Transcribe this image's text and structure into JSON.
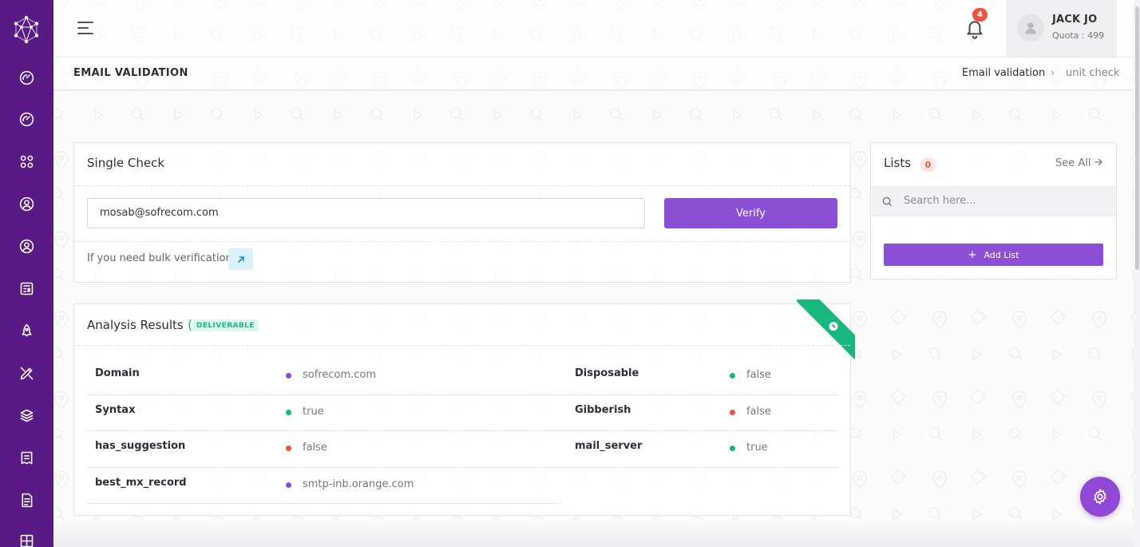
{
  "header": {
    "notification_count": "4",
    "user_name": "JACK JO",
    "user_quota": "Quota : 499"
  },
  "page": {
    "title": "EMAIL VALIDATION",
    "breadcrumb": [
      "Email validation",
      "unit check"
    ]
  },
  "single_check": {
    "title": "Single Check",
    "email_value": "mosab@sofrecom.com",
    "verify_label": "Verify",
    "bulk_text": "If you need bulk verification"
  },
  "analysis": {
    "title": "Analysis Results",
    "paren": "(",
    "status_badge": "DELIVERABLE",
    "rows": [
      {
        "label": "Domain",
        "value": "sofrecom.com",
        "dot": "#8b4fd5"
      },
      {
        "label": "Syntax",
        "value": "true",
        "dot": "#18b87c"
      },
      {
        "label": "has_suggestion",
        "value": "false",
        "dot": "#f0533b"
      },
      {
        "label": "best_mx_record",
        "value": "smtp-inb.orange.com",
        "dot": "#8b4fd5"
      },
      {
        "label": "Disposable",
        "value": "false",
        "dot": "#18b87c"
      },
      {
        "label": "Gibberish",
        "value": "false",
        "dot": "#f0533b"
      },
      {
        "label": "mail_server",
        "value": "true",
        "dot": "#18b87c"
      }
    ]
  },
  "lists": {
    "title": "Lists",
    "count": "0",
    "see_all_label": "See All",
    "search_placeholder": "Search here...",
    "add_list_label": "Add List"
  },
  "colors": {
    "sidebar": "#5a1a86",
    "accent": "#8b4fd5",
    "success": "#18b87c",
    "danger": "#f0533b"
  },
  "icons": {
    "sidebar": [
      "dashboard-icon",
      "speedometer-icon",
      "apps-grid-icon",
      "user-circle-icon",
      "user-profile-icon",
      "newspaper-icon",
      "rocket-icon",
      "design-tools-icon",
      "layers-icon",
      "receipt-icon",
      "file-list-icon",
      "layout-grid-icon"
    ]
  }
}
